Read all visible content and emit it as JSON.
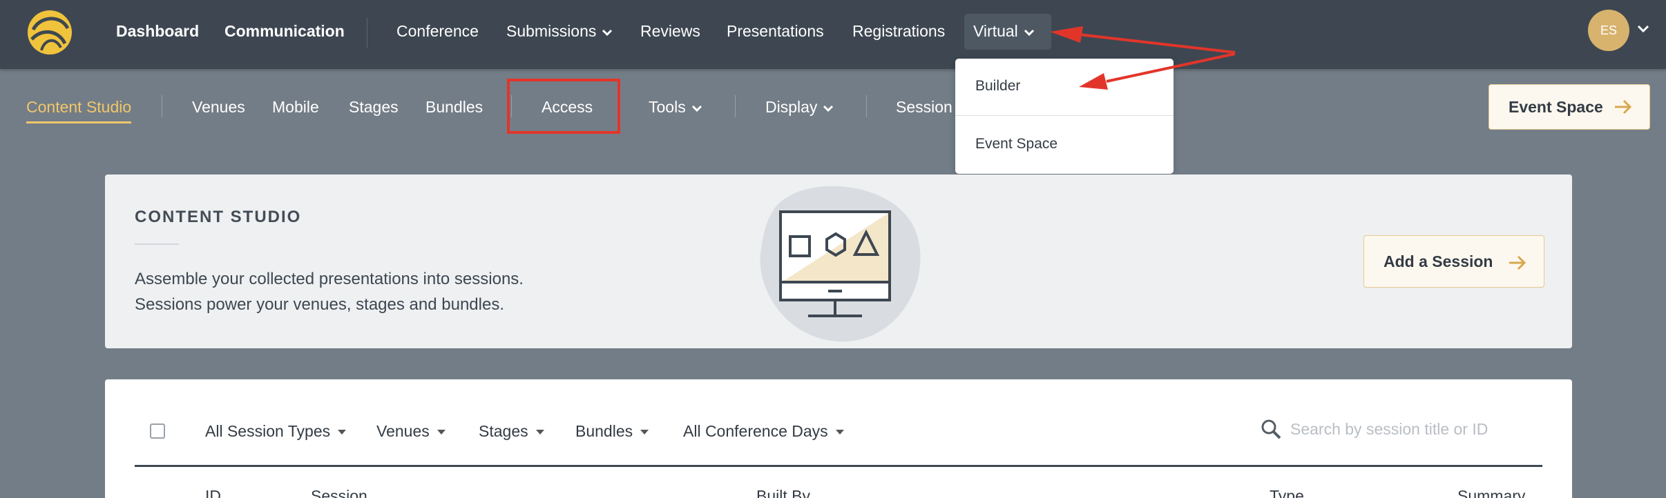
{
  "topnav": {
    "items": [
      {
        "label": "Dashboard"
      },
      {
        "label": "Communication"
      },
      {
        "label": "Conference"
      },
      {
        "label": "Submissions"
      },
      {
        "label": "Reviews"
      },
      {
        "label": "Presentations"
      },
      {
        "label": "Registrations"
      },
      {
        "label": "Virtual"
      }
    ],
    "avatar_initials": "ES"
  },
  "virtual_menu": {
    "items": [
      {
        "label": "Builder"
      },
      {
        "label": "Event Space"
      }
    ]
  },
  "subnav": {
    "items": [
      {
        "label": "Content Studio"
      },
      {
        "label": "Venues"
      },
      {
        "label": "Mobile"
      },
      {
        "label": "Stages"
      },
      {
        "label": "Bundles"
      },
      {
        "label": "Access"
      },
      {
        "label": "Tools"
      },
      {
        "label": "Display"
      },
      {
        "label": "Session C"
      }
    ],
    "event_space_button": "Event Space"
  },
  "hero": {
    "title": "CONTENT STUDIO",
    "desc_line1": "Assemble your collected presentations into sessions.",
    "desc_line2": "Sessions power your venues, stages and bundles.",
    "add_session_button": "Add a Session"
  },
  "filters": {
    "items": [
      {
        "label": "All Session Types"
      },
      {
        "label": "Venues"
      },
      {
        "label": "Stages"
      },
      {
        "label": "Bundles"
      },
      {
        "label": "All Conference Days"
      }
    ],
    "search_placeholder": "Search by session title or ID"
  },
  "table": {
    "columns": [
      "ID",
      "Session",
      "Built By",
      "Type",
      "Summary"
    ]
  },
  "colors": {
    "topbar": "#3e4751",
    "accent": "#f0c76a",
    "annotation": "#e2352a"
  }
}
